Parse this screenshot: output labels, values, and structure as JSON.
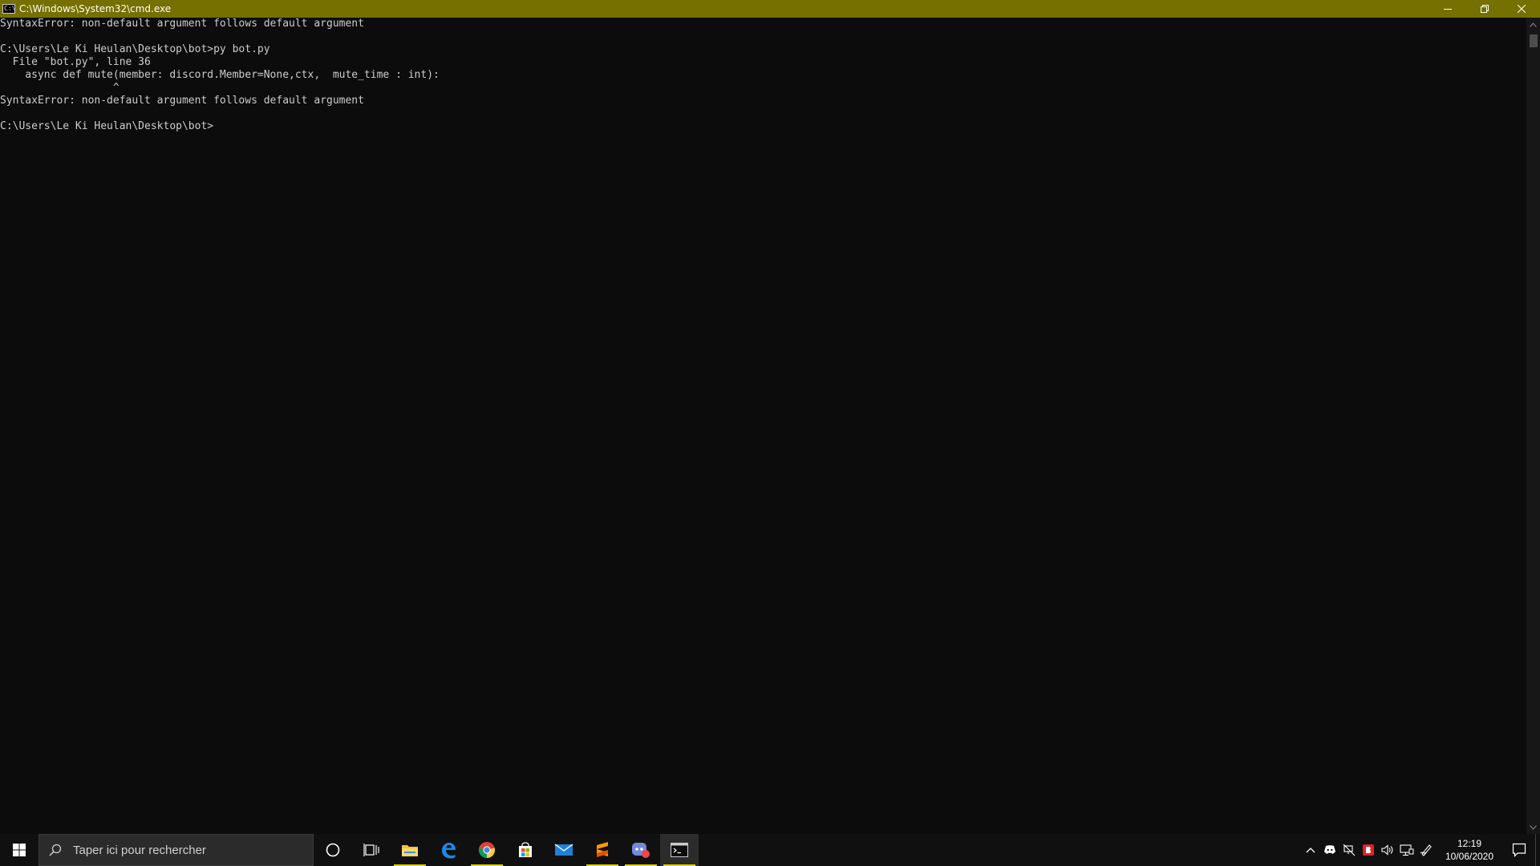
{
  "window": {
    "title": "C:\\Windows\\System32\\cmd.exe",
    "icon": "cmd-icon",
    "titlebar_color": "#767000",
    "controls": [
      "minimize-icon",
      "restore-icon",
      "close-icon"
    ]
  },
  "console": {
    "text_color": "#cccccc",
    "background": "#0c0c0c",
    "lines": [
      "SyntaxError: non-default argument follows default argument",
      "",
      "C:\\Users\\Le Ki Heulan\\Desktop\\bot>py bot.py",
      "  File \"bot.py\", line 36",
      "    async def mute(member: discord.Member=None,ctx,  mute_time : int):",
      "                  ^",
      "SyntaxError: non-default argument follows default argument",
      "",
      "C:\\Users\\Le Ki Heulan\\Desktop\\bot>"
    ]
  },
  "taskbar": {
    "search_placeholder": "Taper ici pour rechercher",
    "accent_color": "#d9d200",
    "apps": [
      {
        "name": "cortana-icon"
      },
      {
        "name": "task-view-icon"
      },
      {
        "name": "file-explorer-icon"
      },
      {
        "name": "edge-icon"
      },
      {
        "name": "chrome-icon"
      },
      {
        "name": "store-icon"
      },
      {
        "name": "mail-icon"
      },
      {
        "name": "sublime-text-icon"
      },
      {
        "name": "discord-icon",
        "badge": "9+"
      },
      {
        "name": "cmd-icon"
      }
    ],
    "tray": [
      "chevron-up-icon",
      "discord-tray-icon",
      "network-disabled-icon",
      "antivirus-icon",
      "volume-icon",
      "network-icon",
      "pen-icon"
    ],
    "clock": {
      "time": "12:19",
      "date": "10/06/2020"
    }
  }
}
